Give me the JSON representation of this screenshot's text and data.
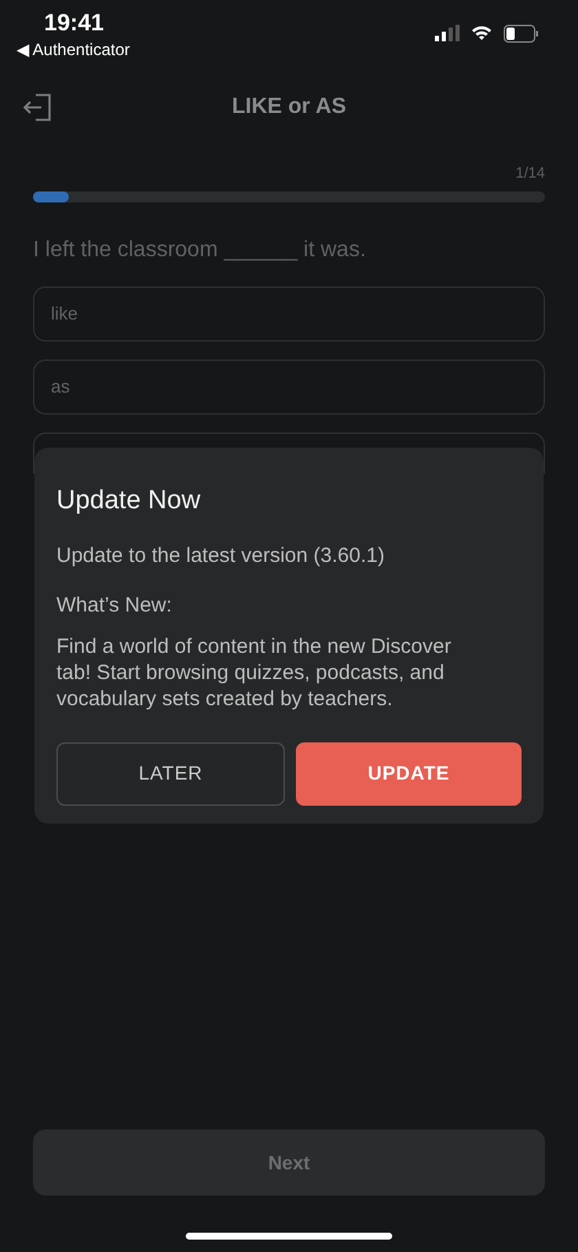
{
  "status_bar": {
    "time": "19:41",
    "back_app": "◀ Authenticator"
  },
  "header": {
    "title": "LIKE or AS"
  },
  "progress": {
    "counter": "1/14",
    "level": 0.07
  },
  "question": "I left the classroom ______ it was.",
  "options": [
    {
      "label": "like"
    },
    {
      "label": "as"
    },
    {
      "kind": "covered"
    }
  ],
  "dialog": {
    "title": "Update Now",
    "version_text": "Update to the latest version (3.60.1)",
    "whats_new_label": "What’s New:",
    "whats_new_text": "Find a world of content in the new Discover tab! Start browsing quizzes, podcasts, and vocabulary sets created by teachers.",
    "buttons": [
      {
        "label": "LATER",
        "kind": "secondary"
      },
      {
        "label": "UPDATE",
        "kind": "primary"
      }
    ]
  },
  "footer": {
    "next_label": "Next",
    "disabled": true
  }
}
